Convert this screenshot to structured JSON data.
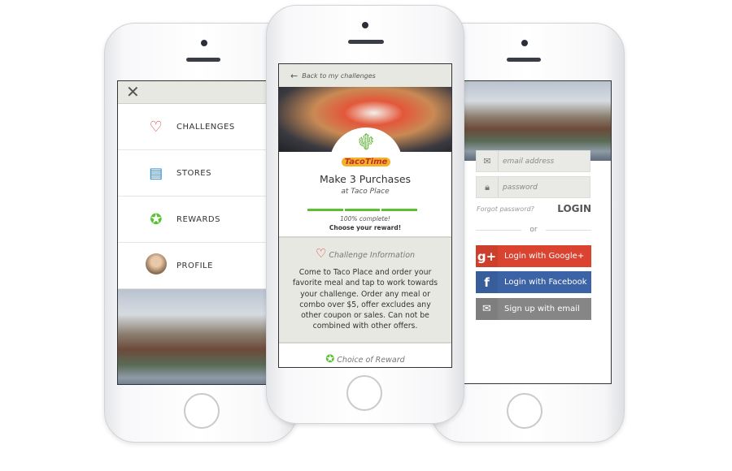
{
  "left_screen": {
    "menu": [
      {
        "label": "CHALLENGES",
        "icon": "heart-icon"
      },
      {
        "label": "STORES",
        "icon": "store-icon"
      },
      {
        "label": "REWARDS",
        "icon": "award-ribbon-icon"
      },
      {
        "label": "PROFILE",
        "icon": "avatar"
      }
    ]
  },
  "middle_screen": {
    "back_label": "Back to my challenges",
    "logo_text": "TacoTime",
    "title": "Make 3 Purchases",
    "subtitle": "at Taco Place",
    "progress_percent": 100,
    "progress_segments": 3,
    "progress_text": "100% complete!",
    "progress_cta": "Choose your reward!",
    "info_heading": "Challenge Information",
    "info_body": "Come to Taco Place and order your favorite meal and tap to work towards your challenge. Order any meal or combo over $5, offer excludes any other coupon or sales. Can not be combined with other offers.",
    "reward_heading": "Choice of Reward",
    "colors": {
      "progress": "#5cc130",
      "heart": "#e0353a"
    }
  },
  "right_screen": {
    "email_placeholder": "email address",
    "password_placeholder": "password",
    "forgot": "Forgot password?",
    "login": "LOGIN",
    "or": "or",
    "google": {
      "label": "Login with Google+",
      "icon_text": "g+",
      "color": "#d9432f"
    },
    "facebook": {
      "label": "Login with Facebook",
      "icon_text": "f",
      "color": "#3b63a5"
    },
    "email_signup": {
      "label": "Sign up with email",
      "color": "#868686"
    }
  }
}
